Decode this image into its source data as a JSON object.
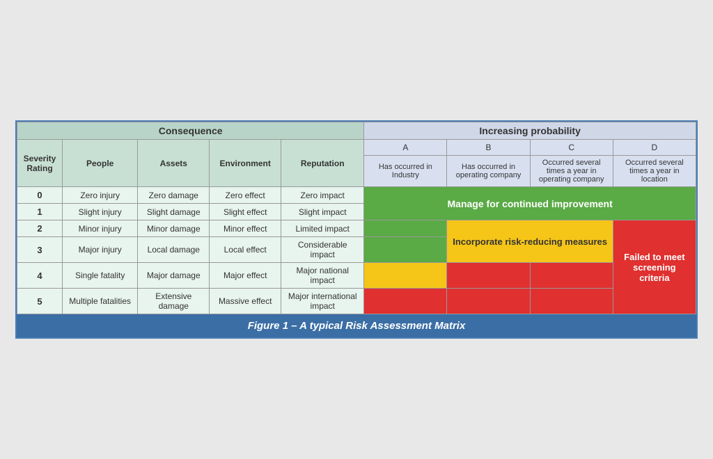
{
  "caption": "Figure 1 – A typical Risk Assessment Matrix",
  "headers": {
    "consequence": "Consequence",
    "probability": "Increasing probability"
  },
  "subheaders": {
    "severity_rating": "Severity Rating",
    "people": "People",
    "assets": "Assets",
    "environment": "Environment",
    "reputation": "Reputation",
    "col_a_label": "A",
    "col_b_label": "B",
    "col_c_label": "C",
    "col_d_label": "D",
    "col_a_desc": "Has occurred in Industry",
    "col_b_desc": "Has occurred in operating company",
    "col_c_desc": "Occurred several times a year in operating company",
    "col_d_desc": "Occurred several times a year in location"
  },
  "rows": [
    {
      "severity": "0",
      "people": "Zero injury",
      "assets": "Zero damage",
      "environment": "Zero effect",
      "reputation": "Zero impact"
    },
    {
      "severity": "1",
      "people": "Slight injury",
      "assets": "Slight damage",
      "environment": "Slight effect",
      "reputation": "Slight impact"
    },
    {
      "severity": "2",
      "people": "Minor injury",
      "assets": "Minor damage",
      "environment": "Minor effect",
      "reputation": "Limited impact"
    },
    {
      "severity": "3",
      "people": "Major injury",
      "assets": "Local damage",
      "environment": "Local effect",
      "reputation": "Considerable impact"
    },
    {
      "severity": "4",
      "people": "Single fatality",
      "assets": "Major damage",
      "environment": "Major effect",
      "reputation": "Major national impact"
    },
    {
      "severity": "5",
      "people": "Multiple fatalities",
      "assets": "Extensive damage",
      "environment": "Massive effect",
      "reputation": "Major international impact"
    }
  ],
  "zone_labels": {
    "green": "Manage for continued improvement",
    "yellow": "Incorporate risk-reducing measures",
    "red": "Failed to meet screening criteria"
  }
}
